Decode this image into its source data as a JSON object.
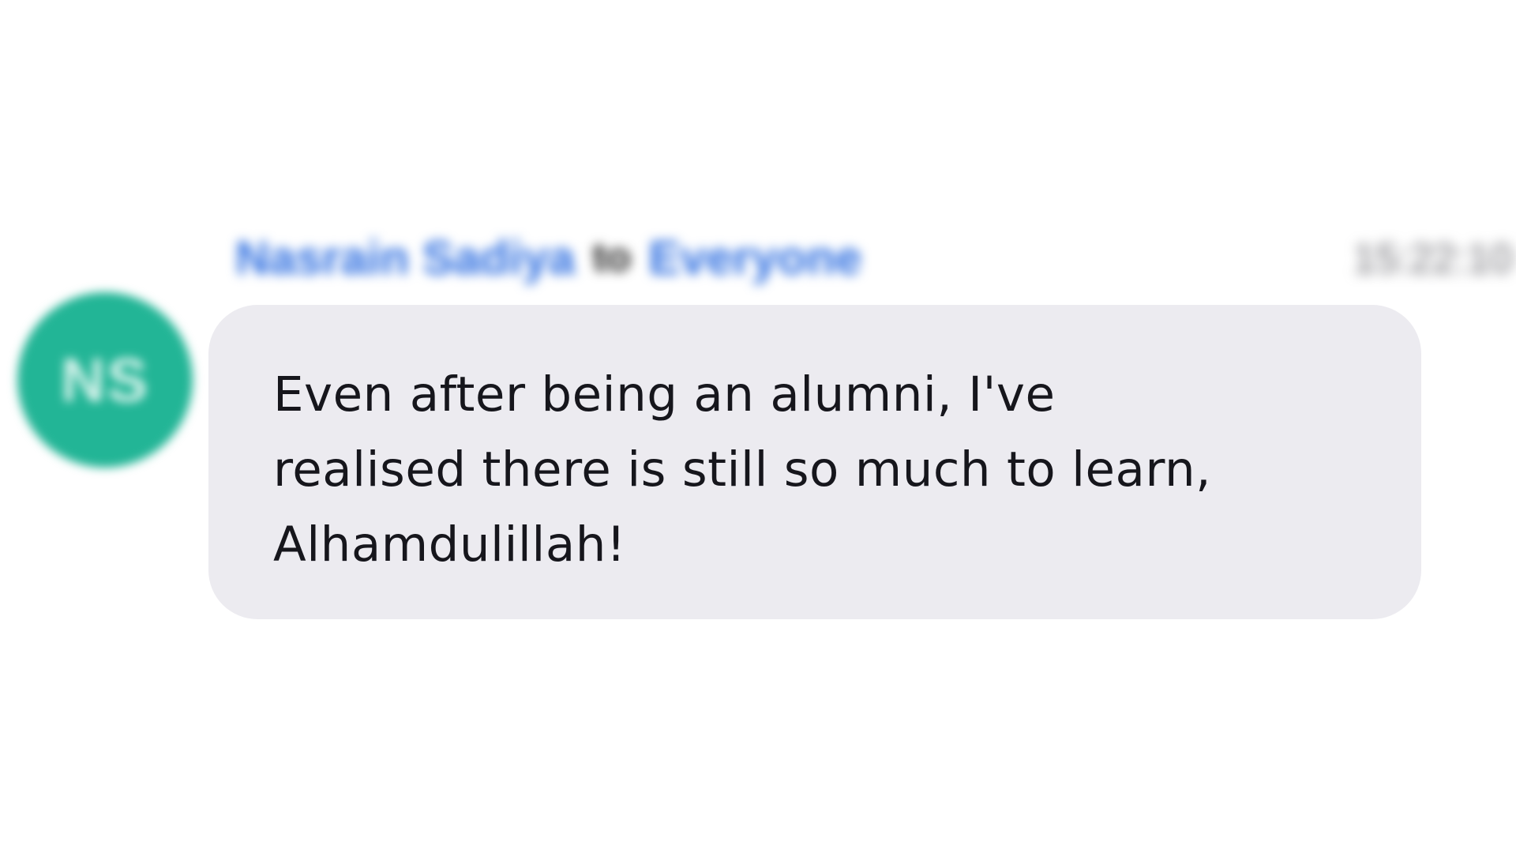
{
  "chat": {
    "sender_name": "Nasrain Sadiya",
    "sender_connector": "to",
    "recipient": "Everyone",
    "timestamp": "15:22:10",
    "avatar": {
      "initials": "NS",
      "color": "#22b596"
    },
    "message_text": "Even after being an alumni, I've\nrealised there is still so much to learn,\nAlhamdulillah!",
    "bubble_color": "#ecebf0",
    "name_color": "#2f6fe0"
  }
}
